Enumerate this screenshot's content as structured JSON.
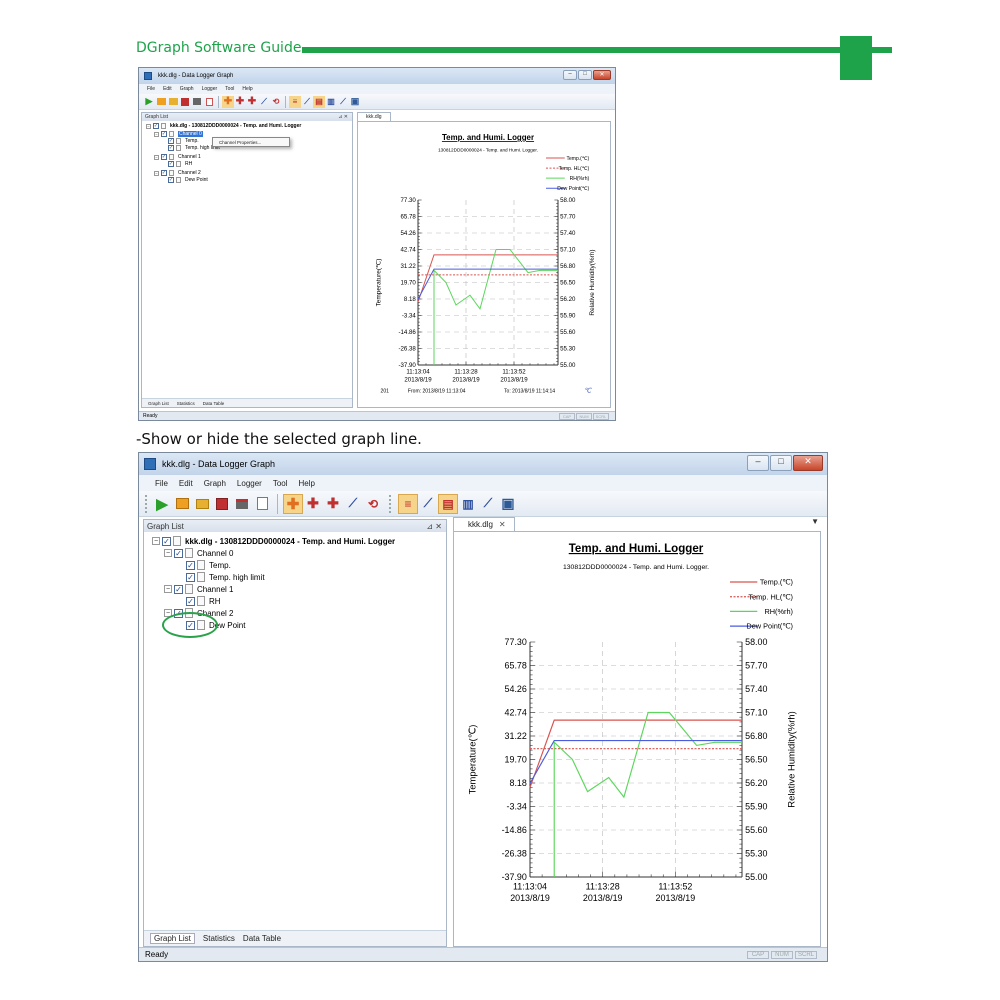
{
  "doc_header": {
    "title": "DGraph Software Guide"
  },
  "caption": "-Show or hide the selected graph line.",
  "window": {
    "title": "kkk.dlg - Data Logger Graph",
    "menu": [
      "File",
      "Edit",
      "Graph",
      "Logger",
      "Tool",
      "Help"
    ],
    "panel_title": "Graph List",
    "tree": {
      "root": "kkk.dlg - 130812DDD0000024 - Temp. and Humi. Logger",
      "channel0": "Channel 0",
      "temp": "Temp.",
      "temp_hl": "Temp. high limit",
      "channel1": "Channel 1",
      "rh": "RH",
      "channel2": "Channel 2",
      "dew": "Dew Point"
    },
    "bottom_tabs": [
      "Graph List",
      "Statistics",
      "Data Table"
    ],
    "doc_tab": "kkk.dlg",
    "status": "Ready",
    "status_indicators": [
      "CAP",
      "NUM",
      "SCRL"
    ],
    "context_menu_item": "Channel Properties...",
    "selected_item": "Channel 0"
  },
  "colors": {
    "brand_green": "#1ea34a",
    "temp": "#d9534f",
    "temp_hl": "#d9534f",
    "rh": "#5cd65c",
    "dew": "#4a5de0"
  },
  "chart_data": {
    "type": "line",
    "title": "Temp. and Humi. Logger",
    "subtitle": "130812DDD0000024 - Temp. and Humi. Logger.",
    "ylabel": "Temperature(℃)",
    "y2label": "Relative Humidity(%rh)",
    "y_ticks": [
      "77.30",
      "65.78",
      "54.26",
      "42.74",
      "31.22",
      "19.70",
      "8.18",
      "-3.34",
      "-14.86",
      "-26.38",
      "-37.90"
    ],
    "y2_ticks": [
      "58.00",
      "57.70",
      "57.40",
      "57.10",
      "56.80",
      "56.50",
      "56.20",
      "55.90",
      "55.60",
      "55.30",
      "55.00"
    ],
    "ylim": [
      -37.9,
      77.3
    ],
    "y2lim": [
      55.0,
      58.0
    ],
    "x_ticks": [
      {
        "time": "11:13:04",
        "date": "2013/8/19"
      },
      {
        "time": "11:13:28",
        "date": "2013/8/19"
      },
      {
        "time": "11:13:52",
        "date": "2013/8/19"
      }
    ],
    "xlim": [
      0,
      70
    ],
    "from_label": "From: 2013/8/19 11:13:04",
    "to_label": "To: 2013/8/19 11:14:14",
    "unit_badge": "℃",
    "legend": [
      "Temp.(℃)",
      "Temp. HL(℃)",
      "RH(%rh)",
      "Dew Point(℃)"
    ],
    "legend_position": "top-right",
    "grid": true,
    "series": [
      {
        "name": "Temp.(℃)",
        "axis": "left",
        "style": "solid",
        "x": [
          0,
          8,
          70
        ],
        "y": [
          6,
          39,
          39
        ]
      },
      {
        "name": "Temp. HL(℃)",
        "axis": "left",
        "style": "dotted",
        "x": [
          0,
          4,
          70
        ],
        "y": [
          25,
          25,
          25
        ]
      },
      {
        "name": "RH(%rh)",
        "axis": "right",
        "style": "solid",
        "x": [
          8,
          8,
          14,
          19,
          26,
          31,
          39,
          46,
          55,
          61,
          70
        ],
        "y": [
          55.0,
          56.72,
          56.5,
          56.09,
          56.27,
          56.02,
          57.1,
          57.1,
          56.68,
          56.72,
          56.72
        ]
      },
      {
        "name": "Dew Point(℃)",
        "axis": "left",
        "style": "solid",
        "x": [
          0,
          8,
          70
        ],
        "y": [
          8,
          29,
          29
        ]
      }
    ]
  }
}
